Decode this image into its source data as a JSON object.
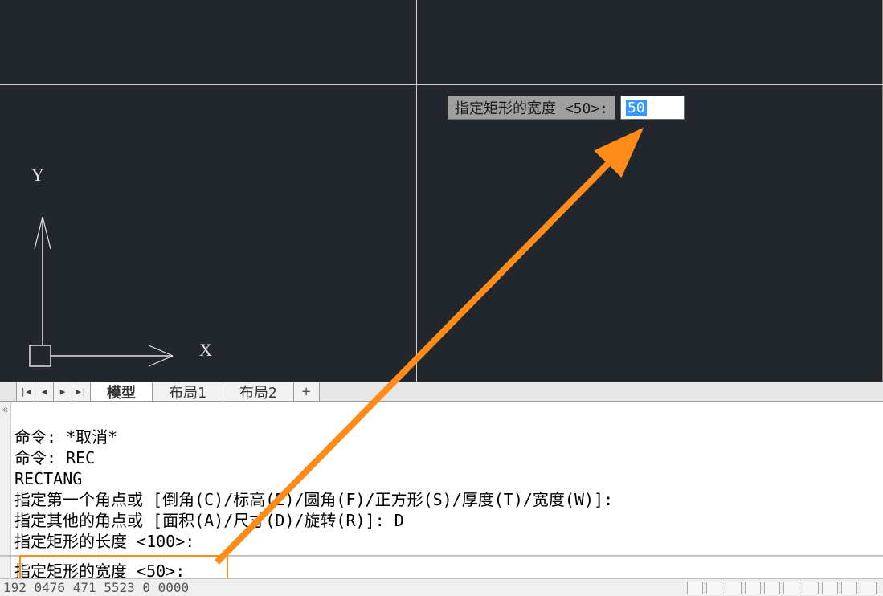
{
  "dynamic_prompt": {
    "prompt_text": "指定矩形的宽度 <50>:",
    "input_value": "50"
  },
  "ucs": {
    "x_label": "X",
    "y_label": "Y"
  },
  "tabs": {
    "nav_first": "|◀",
    "nav_prev": "◀",
    "nav_next": "▶",
    "nav_last": "▶|",
    "items": [
      {
        "label": "模型",
        "active": true
      },
      {
        "label": "布局1",
        "active": false
      },
      {
        "label": "布局2",
        "active": false
      }
    ],
    "add_label": "+"
  },
  "command_history": {
    "gutter_toggle": "«",
    "lines": [
      "命令: *取消*",
      "命令: REC",
      "RECTANG",
      "指定第一个角点或 [倒角(C)/标高(E)/圆角(F)/正方形(S)/厚度(T)/宽度(W)]:",
      "指定其他的角点或 [面积(A)/尺寸(D)/旋转(R)]: D",
      "指定矩形的长度 <100>:"
    ]
  },
  "command_input": {
    "text": "指定矩形的宽度 <50>:"
  },
  "status": {
    "coords_partial": "192 0476  471 5523   0 0000"
  }
}
